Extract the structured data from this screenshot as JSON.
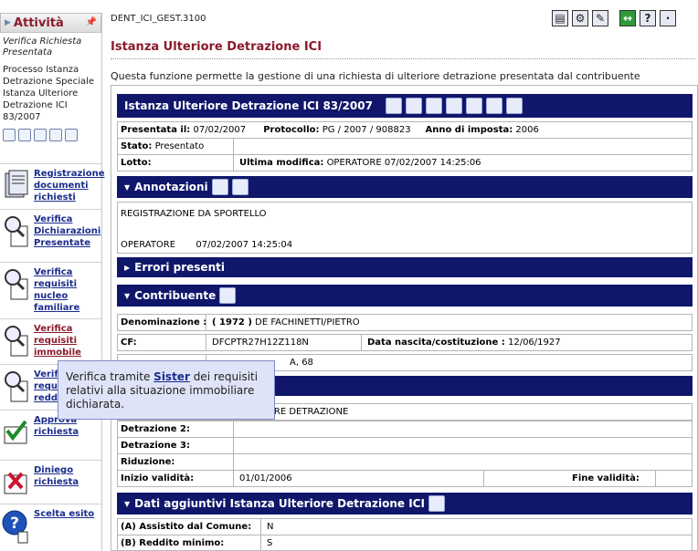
{
  "sidebar": {
    "title": "Attività",
    "subtitle": "Verifica Richiesta Presentata",
    "process": "Processo Istanza Detrazione Speciale Istanza Ulteriore Detrazione ICI 83/2007",
    "items": [
      {
        "label": "Registrazione documenti richiesti",
        "icon": "documents-icon"
      },
      {
        "label": "Verifica Dichiarazioni Presentate",
        "icon": "magnifier-document-icon"
      },
      {
        "label": "Verifica requisiti nucleo familiare",
        "icon": "magnifier-document-icon"
      },
      {
        "label": "Verifica requisiti immobile",
        "icon": "magnifier-document-icon"
      },
      {
        "label": "Verifica requisiti reddito",
        "icon": "magnifier-document-icon"
      },
      {
        "label": "Approva richiesta",
        "icon": "approve-check-icon"
      },
      {
        "label": "Diniego richiesta",
        "icon": "deny-x-icon"
      },
      {
        "label": "Scelta esito",
        "icon": "question-icon"
      }
    ]
  },
  "header": {
    "code": "DENT_ICI_GEST.3100",
    "page_title": "Istanza Ulteriore Detrazione ICI",
    "description": "Questa funzione permette la gestione di una richiesta di ulteriore detrazione presentata dal contribuente"
  },
  "toolbar": {
    "help_label": "?"
  },
  "istanza": {
    "title": "Istanza Ulteriore Detrazione ICI 83/2007",
    "presentata_label": "Presentata il:",
    "presentata_value": "07/02/2007",
    "protocollo_label": "Protocollo:",
    "protocollo_value": "PG / 2007 / 908823",
    "anno_label": "Anno di imposta:",
    "anno_value": "2006",
    "stato_label": "Stato:",
    "stato_value": "Presentato",
    "lotto_label": "Lotto:",
    "ultima_label": "Ultima modifica:",
    "ultima_value": "OPERATORE 07/02/2007 14:25:06"
  },
  "annotazioni": {
    "title": "Annotazioni",
    "text": "REGISTRAZIONE DA SPORTELLO",
    "operator": "OPERATORE",
    "timestamp": "07/02/2007 14:25:04"
  },
  "errori": {
    "title": "Errori presenti"
  },
  "contribuente": {
    "title": "Contribuente",
    "denominazione_label": "Denominazione :",
    "denominazione_code": "( 1972 )",
    "denominazione_value": "DE FACHINETTI/PIETRO",
    "cf_label": "CF:",
    "cf_value": "DFCPTR27H12Z118N",
    "nascita_label": "Data nascita/costituzione :",
    "nascita_value": "12/06/1927",
    "address_partial": "A, 68"
  },
  "detrazione": {
    "value_partial": "ORE DETRAZIONE",
    "det2_label": "Detrazione 2:",
    "det3_label": "Detrazione 3:",
    "riduzione_label": "Riduzione:",
    "inizio_label": "Inizio validità:",
    "inizio_value": "01/01/2006",
    "fine_label": "Fine validità:"
  },
  "dati": {
    "title": "Dati aggiuntivi Istanza Ulteriore Detrazione ICI",
    "assistito_label": "(A) Assistito dal Comune:",
    "assistito_value": "N",
    "reddito_label": "(B) Reddito minimo:",
    "reddito_value": "S"
  },
  "tooltip": {
    "before": "Verifica tramite ",
    "link": "Sister",
    "after": " dei requisiti relativi alla situazione immobiliare dichiarata."
  }
}
